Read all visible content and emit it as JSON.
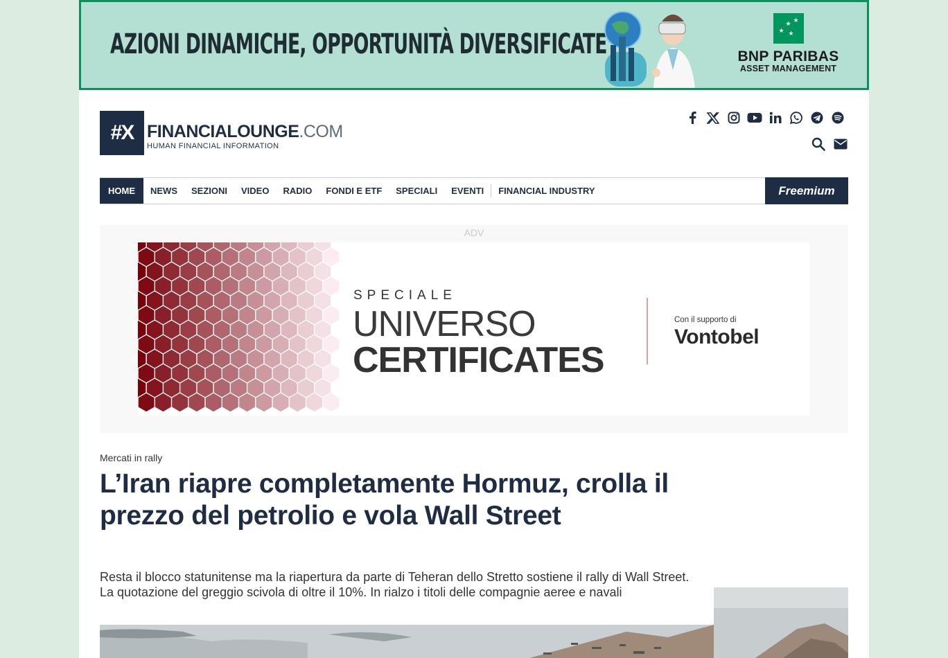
{
  "top_banner": {
    "headline": "AZIONI DINAMICHE, OPPORTUNITÀ DIVERSIFICATE",
    "brand_name": "BNP PARIBAS",
    "brand_sub": "ASSET MANAGEMENT"
  },
  "header": {
    "logo_mark": "#X",
    "logo_word": "FINANCIALOUNGE",
    "logo_suffix": ".COM",
    "logo_tagline": "HUMAN FINANCIAL INFORMATION",
    "social_icons": [
      "facebook-icon",
      "x-icon",
      "instagram-icon",
      "youtube-icon",
      "linkedin-icon",
      "whatsapp-icon",
      "telegram-icon",
      "spotify-icon"
    ],
    "utility_icons": [
      "search-icon",
      "mail-icon"
    ]
  },
  "nav": {
    "items": [
      "HOME",
      "NEWS",
      "SEZIONI",
      "VIDEO",
      "RADIO",
      "FONDI E ETF",
      "SPECIALI",
      "EVENTI",
      "FINANCIAL INDUSTRY"
    ],
    "active": "HOME",
    "freemium": "Freemium"
  },
  "adv": {
    "label": "ADV",
    "speciale": "SPECIALE",
    "line1": "UNIVERSO",
    "line2": "CERTIFICATES",
    "support": "Con il supporto di",
    "sponsor": "Vontobel"
  },
  "article": {
    "kicker": "Mercati in rally",
    "title": "L’Iran riapre completamente Hormuz, crolla il prezzo del petrolio e vola Wall Street",
    "lead": "Resta il blocco statunitense ma la riapertura da parte di Teheran dello Stretto sostiene il rally di Wall Street. La quotazione del greggio scivola di oltre il 10%. In rialzo i titoli delle compagnie aeree e navali"
  },
  "colors": {
    "navy": "#1f2d44",
    "banner_bg": "#b4dfd3",
    "banner_border": "#0d8f5a",
    "bnp_green": "#00965e"
  }
}
